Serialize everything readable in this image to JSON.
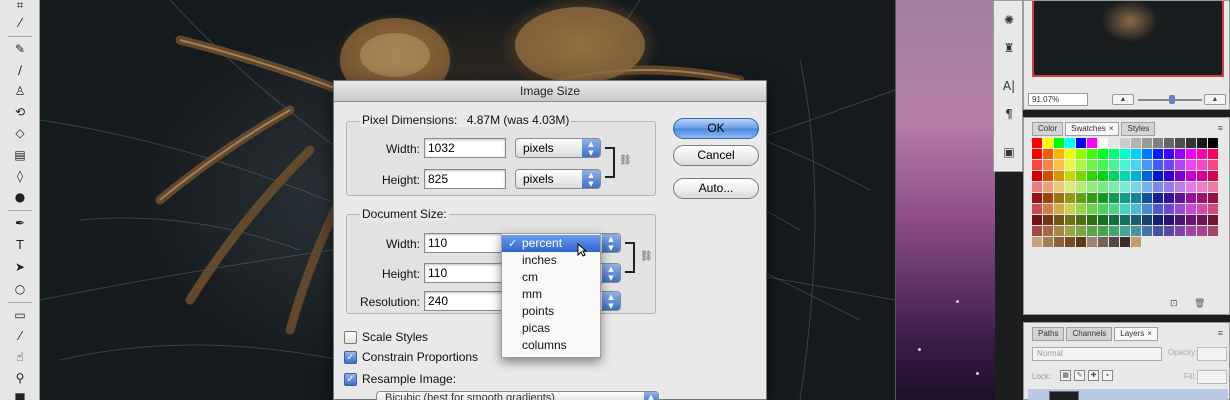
{
  "dialog": {
    "title": "Image Size",
    "pixel_dimensions": {
      "label": "Pixel Dimensions:",
      "value": "4.87M (was 4.03M)",
      "width_label": "Width:",
      "width_value": "1032",
      "width_unit": "pixels",
      "height_label": "Height:",
      "height_value": "825",
      "height_unit": "pixels"
    },
    "document_size": {
      "label": "Document Size:",
      "width_label": "Width:",
      "width_value": "110",
      "height_label": "Height:",
      "height_value": "110",
      "resolution_label": "Resolution:",
      "resolution_value": "240"
    },
    "buttons": {
      "ok": "OK",
      "cancel": "Cancel",
      "auto": "Auto..."
    },
    "scale_styles": {
      "label": "Scale Styles",
      "checked": false
    },
    "constrain_proportions": {
      "label": "Constrain Proportions",
      "checked": true
    },
    "resample_image": {
      "label": "Resample Image:",
      "checked": true
    },
    "resample_method": "Bicubic (best for smooth gradients)"
  },
  "unit_menu": {
    "selected": "percent",
    "items": [
      "percent",
      "inches",
      "cm",
      "mm",
      "points",
      "picas",
      "columns"
    ]
  },
  "navigator": {
    "zoom": "91.07%"
  },
  "swatches_panel": {
    "tabs": [
      "Color",
      "Swatches",
      "Styles"
    ],
    "active_tab": "Swatches"
  },
  "layers_panel": {
    "tabs": [
      "Paths",
      "Channels",
      "Layers"
    ],
    "active_tab": "Layers",
    "blend_mode": "Normal",
    "opacity_label": "Opacity:",
    "lock_label": "Lock:",
    "fill_label": "Fill:"
  },
  "accent_color": "#3d6fc7",
  "icons": {
    "toolbar": [
      "crop-icon",
      "eyedropper-icon",
      "healing-brush-icon",
      "brush-icon",
      "clone-stamp-icon",
      "history-brush-icon",
      "eraser-icon",
      "gradient-icon",
      "blur-icon",
      "dodge-icon",
      "pen-icon",
      "type-icon",
      "path-selection-icon",
      "shape-icon",
      "notes-icon",
      "eyedropper-2-icon",
      "hand-icon",
      "zoom-icon"
    ],
    "mini_strip": [
      "brushes-icon",
      "tool-presets-icon",
      "character-icon",
      "paragraph-icon",
      "layer-comps-icon"
    ]
  }
}
